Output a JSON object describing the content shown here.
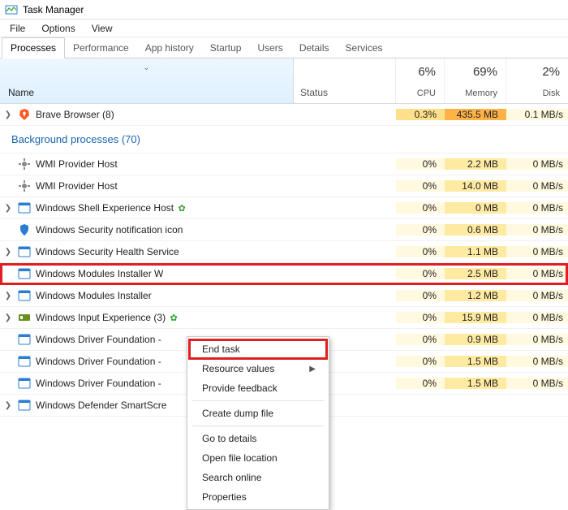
{
  "window": {
    "title": "Task Manager"
  },
  "menubar": [
    "File",
    "Options",
    "View"
  ],
  "tabs": [
    "Processes",
    "Performance",
    "App history",
    "Startup",
    "Users",
    "Details",
    "Services"
  ],
  "active_tab": 0,
  "columns": {
    "name": "Name",
    "status": "Status",
    "cpu": {
      "pct": "6%",
      "label": "CPU"
    },
    "memory": {
      "pct": "69%",
      "label": "Memory"
    },
    "disk": {
      "pct": "2%",
      "label": "Disk"
    }
  },
  "group_label": "Background processes (70)",
  "rows": [
    {
      "expandable": true,
      "icon": "brave",
      "name": "Brave Browser (8)",
      "cpu": "0.3%",
      "mem": "435.5 MB",
      "disk": "0.1 MB/s",
      "leaf": false,
      "cpu_hl": true,
      "mem_hl": true
    },
    {
      "group": true
    },
    {
      "expandable": false,
      "icon": "gear",
      "name": "WMI Provider Host",
      "cpu": "0%",
      "mem": "2.2 MB",
      "disk": "0 MB/s"
    },
    {
      "expandable": false,
      "icon": "gear",
      "name": "WMI Provider Host",
      "cpu": "0%",
      "mem": "14.0 MB",
      "disk": "0 MB/s"
    },
    {
      "expandable": true,
      "icon": "app",
      "name": "Windows Shell Experience Host",
      "cpu": "0%",
      "mem": "0 MB",
      "disk": "0 MB/s",
      "leaf": true
    },
    {
      "expandable": false,
      "icon": "shield",
      "name": "Windows Security notification icon",
      "cpu": "0%",
      "mem": "0.6 MB",
      "disk": "0 MB/s"
    },
    {
      "expandable": true,
      "icon": "app",
      "name": "Windows Security Health Service",
      "cpu": "0%",
      "mem": "1.1 MB",
      "disk": "0 MB/s"
    },
    {
      "expandable": false,
      "icon": "app",
      "name": "Windows Modules Installer W",
      "cpu": "0%",
      "mem": "2.5 MB",
      "disk": "0 MB/s",
      "selected": true
    },
    {
      "expandable": true,
      "icon": "app",
      "name": "Windows Modules Installer",
      "cpu": "0%",
      "mem": "1.2 MB",
      "disk": "0 MB/s"
    },
    {
      "expandable": true,
      "icon": "input",
      "name": "Windows Input Experience (3)",
      "cpu": "0%",
      "mem": "15.9 MB",
      "disk": "0 MB/s",
      "leaf": true
    },
    {
      "expandable": false,
      "icon": "app",
      "name": "Windows Driver Foundation -",
      "cpu": "0%",
      "mem": "0.9 MB",
      "disk": "0 MB/s"
    },
    {
      "expandable": false,
      "icon": "app",
      "name": "Windows Driver Foundation -",
      "cpu": "0%",
      "mem": "1.5 MB",
      "disk": "0 MB/s"
    },
    {
      "expandable": false,
      "icon": "app",
      "name": "Windows Driver Foundation -",
      "cpu": "0%",
      "mem": "1.5 MB",
      "disk": "0 MB/s"
    },
    {
      "expandable": true,
      "icon": "app",
      "name": "Windows Defender SmartScre",
      "cpu": "",
      "mem": "",
      "disk": ""
    }
  ],
  "context_menu": [
    {
      "label": "End task",
      "highlighted": true
    },
    {
      "label": "Resource values",
      "submenu": true
    },
    {
      "label": "Provide feedback"
    },
    {
      "sep": true
    },
    {
      "label": "Create dump file"
    },
    {
      "sep": true
    },
    {
      "label": "Go to details"
    },
    {
      "label": "Open file location"
    },
    {
      "label": "Search online"
    },
    {
      "label": "Properties"
    }
  ]
}
